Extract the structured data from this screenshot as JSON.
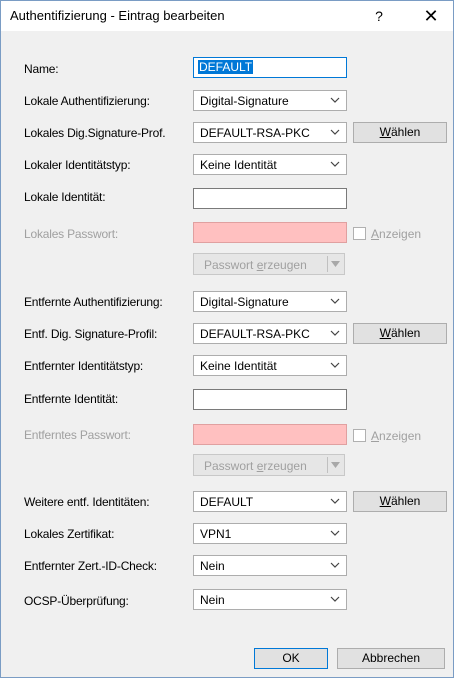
{
  "window": {
    "title": "Authentifizierung - Eintrag bearbeiten",
    "help": "?",
    "close": "✕"
  },
  "form": {
    "name": {
      "label": "Name:",
      "value": "DEFAULT"
    },
    "lokale_auth": {
      "label": "Lokale Authentifizierung:",
      "value": "Digital-Signature"
    },
    "lokales_profil": {
      "label": "Lokales Dig.Signature-Prof.",
      "value": "DEFAULT-RSA-PKC",
      "button_prefix": "W",
      "button_rest": "ählen"
    },
    "lokaler_typ": {
      "label": "Lokaler Identitätstyp:",
      "value": "Keine Identität"
    },
    "lokale_identitaet": {
      "label": "Lokale Identität:",
      "value": ""
    },
    "lokales_passwort": {
      "label": "Lokales Passwort:",
      "value": "",
      "checkbox_prefix": "A",
      "checkbox_rest": "nzeigen"
    },
    "lokal_pw_button": {
      "pre": "Passwort ",
      "u": "e",
      "post": "rzeugen"
    },
    "entfernte_auth": {
      "label": "Entfernte Authentifizierung:",
      "value": "Digital-Signature"
    },
    "entf_profil": {
      "label": "Entf. Dig. Signature-Profil:",
      "value": "DEFAULT-RSA-PKC",
      "button_prefix": "W",
      "button_rest": "ählen"
    },
    "entf_typ": {
      "label": "Entfernter Identitätstyp:",
      "value": "Keine Identität"
    },
    "entf_identitaet": {
      "label": "Entfernte Identität:",
      "value": ""
    },
    "entf_passwort": {
      "label": "Entferntes Passwort:",
      "value": "",
      "checkbox_prefix": "A",
      "checkbox_rest": "nzeigen"
    },
    "entf_pw_button": {
      "pre": "Passwort ",
      "u": "e",
      "post": "rzeugen"
    },
    "weitere": {
      "label": "Weitere entf. Identitäten:",
      "value": "DEFAULT",
      "button_prefix": "W",
      "button_rest": "ählen"
    },
    "zertifikat": {
      "label": "Lokales Zertifikat:",
      "value": "VPN1"
    },
    "zert_check": {
      "label": "Entfernter Zert.-ID-Check:",
      "value": "Nein"
    },
    "ocsp": {
      "label": "OCSP-Überprüfung:",
      "value": "Nein"
    }
  },
  "footer": {
    "ok": "OK",
    "cancel": "Abbrechen"
  }
}
